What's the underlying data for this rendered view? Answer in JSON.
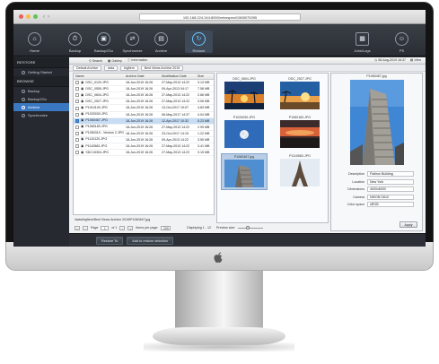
{
  "browser": {
    "url": "192.168.224.244:8000/retrospect/1565075395"
  },
  "toolbar": {
    "tools": [
      {
        "label": "Home",
        "icon": "home-icon"
      },
      {
        "label": "Backup",
        "icon": "backup-icon"
      },
      {
        "label": "Backup2Go",
        "icon": "backup2go-icon"
      },
      {
        "label": "Synchronize",
        "icon": "synchronize-icon"
      },
      {
        "label": "Archive",
        "icon": "archive-icon"
      },
      {
        "label": "Restore",
        "icon": "restore-icon"
      }
    ],
    "right_tools": [
      {
        "label": "Jobs/Logs",
        "icon": "jobs-logs-icon"
      },
      {
        "label": "PS",
        "icon": "user-icon"
      }
    ]
  },
  "sidebar": {
    "restore_heading": "RESTORE",
    "restore_items": [
      {
        "label": "Getting Started"
      }
    ],
    "browse_heading": "BROWSE",
    "browse_items": [
      {
        "label": "Backup"
      },
      {
        "label": "Backup2Go"
      },
      {
        "label": "Archive",
        "active": true
      },
      {
        "label": "Synchronize"
      }
    ]
  },
  "subtoolbar": {
    "search_label": "Search",
    "gallery_label": "Gallery",
    "information_label": "Information",
    "date": "08-Aug-2019 16:37",
    "view_label": "View"
  },
  "breadcrumbs": [
    "Default Archive",
    "data",
    "bigfiers",
    "Best Views Archive 2015"
  ],
  "file_table": {
    "columns": [
      "Name",
      "Archive Date",
      "Modification Date",
      "Size"
    ],
    "rows": [
      {
        "name": "DSC_0120.JPG",
        "archive": "18-Jun-2019 16:26",
        "modified": "27-May-2013 14:22",
        "size": "3.13 MB",
        "checked": false,
        "selected": false
      },
      {
        "name": "DSC_0555.JPG",
        "archive": "18-Jun-2019 16:26",
        "modified": "09-Apr-2013 04:17",
        "size": "7.58 MB",
        "checked": false,
        "selected": false
      },
      {
        "name": "DSC_0604.JPG",
        "archive": "18-Jun-2019 16:26",
        "modified": "27-May-2013 14:22",
        "size": "2.66 MB",
        "checked": false,
        "selected": false
      },
      {
        "name": "DSC_2527.JPG",
        "archive": "18-Jun-2019 16:26",
        "modified": "27-May-2013 14:22",
        "size": "3.06 MB",
        "checked": false,
        "selected": false
      },
      {
        "name": "P1010100.JPG",
        "archive": "18-Jun-2019 16:26",
        "modified": "13-Oct-2017 19:07",
        "size": "4.83 MB",
        "checked": false,
        "selected": false
      },
      {
        "name": "P1020030.JPG",
        "archive": "18-Jun-2019 16:26",
        "modified": "06-May-2017 14:37",
        "size": "4.04 MB",
        "checked": false,
        "selected": false
      },
      {
        "name": "P1060467.JPG",
        "archive": "18-Jun-2019 16:26",
        "modified": "12-Apr-2017 10:32",
        "size": "5.23 MB",
        "checked": true,
        "selected": true
      },
      {
        "name": "P1060183.JPG",
        "archive": "18-Jun-2019 16:26",
        "modified": "27-May-2013 14:22",
        "size": "2.99 MB",
        "checked": false,
        "selected": false
      },
      {
        "name": "P1050319 - Version 2.JPG",
        "archive": "18-Jun-2019 16:26",
        "modified": "23-Oct-2017 14:15",
        "size": "1.22 MB",
        "checked": false,
        "selected": false
      },
      {
        "name": "P1110120.JPG",
        "archive": "18-Jun-2019 16:26",
        "modified": "09-Apr-2013 14:22",
        "size": "3.55 MB",
        "checked": false,
        "selected": false
      },
      {
        "name": "P1110583.JPG",
        "archive": "18-Jun-2019 16:26",
        "modified": "27-May-2013 14:22",
        "size": "3.41 MB",
        "checked": false,
        "selected": false
      },
      {
        "name": "SDC15304.JPG",
        "archive": "18-Jun-2019 16:26",
        "modified": "27-May-2013 14:22",
        "size": "3.15 MB",
        "checked": false,
        "selected": false
      }
    ]
  },
  "path_bar": "/data/bigfiers/Best Views Archive 2015/P1060467.jpg",
  "pager": {
    "page_label": "Page",
    "page_value": "1",
    "of_label": "of 1",
    "items_per_page_label": "Items per page:",
    "items_per_page_value": "200",
    "displaying": "Displaying 1 - 12"
  },
  "thumbnails": [
    {
      "caption": "DSC_0604.JPG",
      "scene": "sunset-palms"
    },
    {
      "caption": "DSC_2527.JPG",
      "scene": "sunset-beach"
    },
    {
      "caption": "P1020030.JPG",
      "scene": "moon"
    },
    {
      "caption": "P1060183.JPG",
      "scene": "sunset-clouds"
    },
    {
      "caption": "P1060467.jpg",
      "scene": "flatiron",
      "selected": true
    },
    {
      "caption": "P1110583.JPG",
      "scene": "eiffel"
    }
  ],
  "preview_size_label": "Preview size:",
  "preview": {
    "title": "P1060467.jpg",
    "meta": [
      {
        "label": "Description",
        "value": "Flatiron Building"
      },
      {
        "label": "Location",
        "value": "New York"
      },
      {
        "label": "Dimensions",
        "value": "4000x6000"
      },
      {
        "label": "Camera",
        "value": "NIKON D610"
      },
      {
        "label": "Color space",
        "value": "sRGB"
      }
    ],
    "apply_label": "Apply"
  },
  "bottom_bar": {
    "restore_to_label": "Restore To",
    "add_to_selection_label": "Add to restore selection"
  },
  "colors": {
    "accent": "#3a78c2",
    "selection": "#c6dcf4",
    "toolbar_bg": "#2a2e34"
  }
}
